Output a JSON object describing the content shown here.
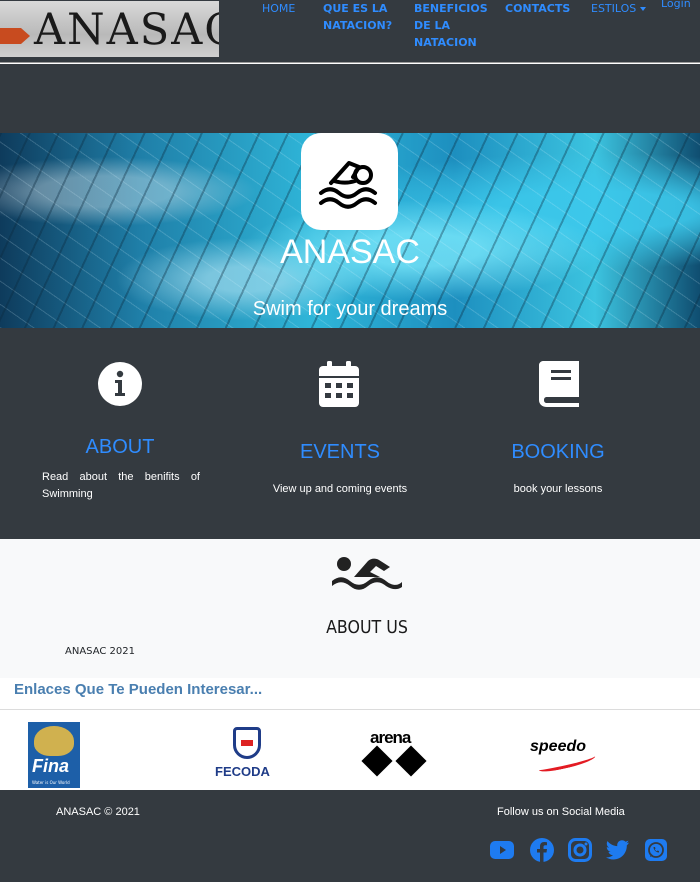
{
  "brand": {
    "logo_text": "ANASAC"
  },
  "nav": {
    "home": "HOME",
    "que_es": "QUE ES LA NATACION?",
    "beneficios": "BENEFICIOS DE LA NATACION",
    "contacts": "CONTACTS",
    "estilos": "ESTILOS",
    "login": "Login"
  },
  "hero": {
    "icon": "swimmer-icon",
    "title": "ANASAC",
    "subtitle": "Swim for your dreams"
  },
  "features": [
    {
      "icon": "info-circle-icon",
      "title": "ABOUT",
      "text": "Read about the benifits of Swimming"
    },
    {
      "icon": "calendar-icon",
      "title": "EVENTS",
      "text": "View up and coming events"
    },
    {
      "icon": "book-icon",
      "title": "BOOKING",
      "text": "book your lessons"
    }
  ],
  "about": {
    "icon": "swimmer-icon",
    "title": "ABOUT US",
    "year": "ANASAC 2021"
  },
  "links": {
    "heading": "Enlaces Que Te Pueden Interesar...",
    "partners": [
      "Fina",
      "FECODA",
      "arena",
      "speedo"
    ],
    "fina_tagline": "Water is Our World"
  },
  "footer": {
    "copyright": "ANASAC © 2021",
    "follow": "Follow us on Social Media",
    "social": [
      "youtube-icon",
      "facebook-icon",
      "instagram-icon",
      "twitter-icon",
      "whatsapp-icon"
    ]
  },
  "colors": {
    "dark": "#343a40",
    "link": "#2f8cff",
    "heading_blue": "#4a7fb0",
    "light": "#f8f9fa"
  }
}
